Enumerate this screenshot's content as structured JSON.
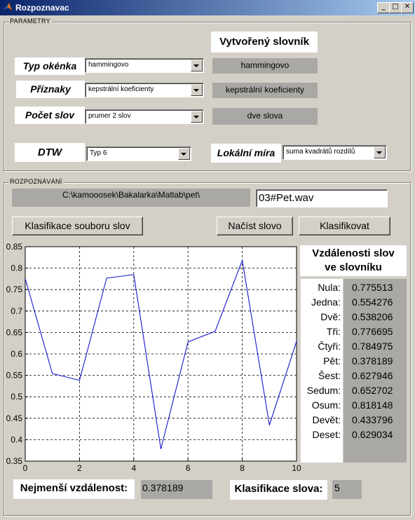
{
  "window": {
    "title": "Rozpoznavac"
  },
  "parametry": {
    "title": "PARAMETRY",
    "slovnik_title": "Vytvořený slovník",
    "typ_okenka": {
      "label": "Typ okénka",
      "value": "hammingovo",
      "slovnik": "hammingovo"
    },
    "priznaky": {
      "label": "Příznaky",
      "value": "kepstrální koeficienty",
      "slovnik": "kepstrální koeficienty"
    },
    "pocet_slov": {
      "label": "Počet slov",
      "value": "prumer 2 slov",
      "slovnik": "dve slova"
    },
    "dtw": {
      "label": "DTW",
      "value": "Typ 6"
    },
    "lokalni_mira": {
      "label": "Lokální míra",
      "value": "suma kvadrátů rozdílů"
    }
  },
  "rozpoznavani": {
    "title": "ROZPOZNÁVÁNÍ",
    "path": "C:\\kamooosek\\Bakalarka\\Matlab\\pet\\",
    "filename": "03#Pet.wav",
    "btn_klasifikace_souboru": "Klasifikace souboru slov",
    "btn_nacist": "Načíst slovo",
    "btn_klasifikovat": "Klasifikovat",
    "vzdalenosti_title_1": "Vzdálenosti slov",
    "vzdalenosti_title_2": "ve slovníku",
    "words": [
      {
        "name": "Nula:",
        "value": "0.775513"
      },
      {
        "name": "Jedna:",
        "value": "0.554276"
      },
      {
        "name": "Dvě:",
        "value": "0.538206"
      },
      {
        "name": "Tři:",
        "value": "0.776695"
      },
      {
        "name": "Čtyři:",
        "value": "0.784975"
      },
      {
        "name": "Pět:",
        "value": "0.378189"
      },
      {
        "name": "Šest:",
        "value": "0.627946"
      },
      {
        "name": "Sedum:",
        "value": "0.652702"
      },
      {
        "name": "Osum:",
        "value": "0.818148"
      },
      {
        "name": "Devět:",
        "value": "0.433796"
      },
      {
        "name": "Deset:",
        "value": "0.629034"
      }
    ],
    "nejmensi_label": "Nejmenší vzdálenost:",
    "nejmensi_value": "0.378189",
    "klasifikace_label": "Klasifikace slova:",
    "klasifikace_value": "5"
  },
  "chart_data": {
    "type": "line",
    "title": "",
    "xlabel": "",
    "ylabel": "",
    "x": [
      0,
      1,
      2,
      3,
      4,
      5,
      6,
      7,
      8,
      9,
      10
    ],
    "values": [
      0.775513,
      0.554276,
      0.538206,
      0.776695,
      0.784975,
      0.378189,
      0.627946,
      0.652702,
      0.818148,
      0.433796,
      0.629034
    ],
    "xlim": [
      0,
      10
    ],
    "ylim": [
      0.35,
      0.85
    ],
    "xticks": [
      0,
      2,
      4,
      6,
      8,
      10
    ],
    "yticks": [
      0.35,
      0.4,
      0.45,
      0.5,
      0.55,
      0.6,
      0.65,
      0.7,
      0.75,
      0.8,
      0.85
    ],
    "grid": true,
    "line_color": "#0000cc"
  }
}
